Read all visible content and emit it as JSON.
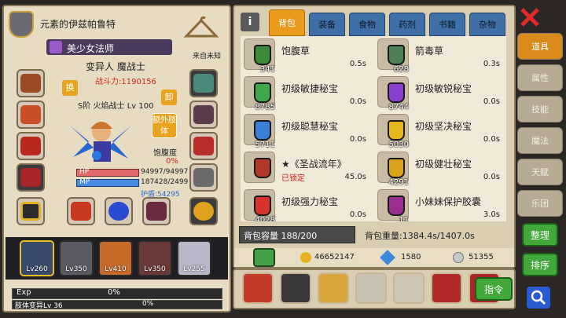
{
  "character": {
    "header_name": "元素的伊兹帕鲁特",
    "class_title": "美少女法师",
    "subtitle": "变异人 魔战士",
    "come_from": "来自未知",
    "power": "战斗力:1190156",
    "rank_text": "S阶 火焰战士 Lv 100",
    "swap_btn": "换",
    "unload_btn": "卸",
    "extra_body_btn": "额外肢体",
    "satiety_label": "饱腹度",
    "satiety_value": "0%",
    "hp_label": "HP",
    "hp_value": "94997/94997",
    "mp_label": "MP",
    "mp_value": "187428/2499",
    "guard": "护盾:54295"
  },
  "heroes": [
    {
      "level": "Lv260"
    },
    {
      "level": "Lv350"
    },
    {
      "level": "Lv410"
    },
    {
      "level": "Lv350"
    },
    {
      "level": "Lv255"
    }
  ],
  "exp": {
    "label": "Exp",
    "value": "0%",
    "sub_label": "肢体变异Lv 36",
    "sub_value": "0%"
  },
  "tabs": [
    "背包",
    "装备",
    "食物",
    "药剂",
    "书籍",
    "杂物"
  ],
  "items": [
    {
      "name": "饱腹草",
      "count": "341",
      "time": "0.5s",
      "color": "#3d8a3a"
    },
    {
      "name": "箭毒草",
      "count": "628",
      "time": "0.3s",
      "color": "#4f7f56"
    },
    {
      "name": "初级敏捷秘宝",
      "count": "8785",
      "time": "0.0s",
      "color": "#3fa84a"
    },
    {
      "name": "初级敏锐秘宝",
      "count": "8744",
      "time": "0.0s",
      "color": "#8a3fcf"
    },
    {
      "name": "初级聪慧秘宝",
      "count": "5711",
      "time": "0.0s",
      "color": "#3b7fd6"
    },
    {
      "name": "初级坚决秘宝",
      "count": "5030",
      "time": "0.0s",
      "color": "#e7b51e"
    },
    {
      "name": "★《圣战流年》",
      "count": "",
      "time": "45.0s",
      "color": "#b2382a",
      "locked": "已锁定"
    },
    {
      "name": "初级健壮秘宝",
      "count": "4291",
      "time": "0.0s",
      "color": "#dca21c"
    },
    {
      "name": "初级强力秘宝",
      "count": "4028",
      "time": "0.0s",
      "color": "#d8322c"
    },
    {
      "name": "小妹妹保护胶囊",
      "count": "11",
      "time": "3.0s",
      "color": "#9b2f8f"
    }
  ],
  "bag": {
    "capacity": "背包容量 188/200",
    "weight": "背包重量:1384.4s/1407.0s"
  },
  "currency": {
    "gold": "46652147",
    "gem": "1580",
    "silver": "51355"
  },
  "side_tabs": [
    "道具",
    "属性",
    "技能",
    "魔法",
    "天赋",
    "乐团"
  ],
  "buttons": {
    "sort": "整理",
    "order": "排序",
    "command": "指令"
  },
  "colors": {
    "accent": "#e99b1e",
    "tab_blue": "#3e6fa6",
    "green": "#42a83a"
  }
}
